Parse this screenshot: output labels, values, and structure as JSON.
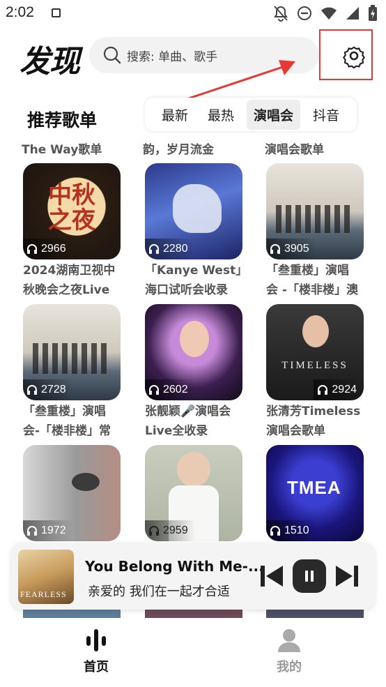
{
  "status": {
    "time": "2:02"
  },
  "header": {
    "title": "发现",
    "search_placeholder": "搜索: 单曲、歌手"
  },
  "section": {
    "title": "推荐歌单",
    "tabs": [
      "最新",
      "最热",
      "演唱会",
      "抖音"
    ],
    "active_tab": "演唱会"
  },
  "top_captions": [
    "The Way歌单",
    "韵，岁月流金",
    "演唱会歌单"
  ],
  "playlists": [
    {
      "plays": "2966",
      "title": "2024湖南卫视中\n秋晚会之夜Live",
      "cover_text": "中秋之夜"
    },
    {
      "plays": "2280",
      "title": "「Kanye West」\n海口试听会收录"
    },
    {
      "plays": "3905",
      "title": "「叁重楼」演唱\n会 -「楼非楼」澳"
    },
    {
      "plays": "2728",
      "title": "「叁重楼」演唱\n会-「楼非楼」常"
    },
    {
      "plays": "2602",
      "title": "张靓颖🎤演唱会\nLive全收录"
    },
    {
      "plays": "2924",
      "title": "张清芳Timeless\n演唱会歌单",
      "cover_text": "TIMELESS"
    },
    {
      "plays": "1972"
    },
    {
      "plays": "2959"
    },
    {
      "plays": "1510",
      "cover_text": "TMEA"
    }
  ],
  "player": {
    "title": "You Belong With Me-...",
    "lyric": "亲爱的 我们在一起才合适",
    "art_text": "FEARLESS"
  },
  "nav": {
    "home": "首页",
    "mine": "我的"
  },
  "colors": {
    "annotation": "#e53935",
    "text": "#111111",
    "muted": "#555555",
    "nav_inactive": "#999999"
  }
}
